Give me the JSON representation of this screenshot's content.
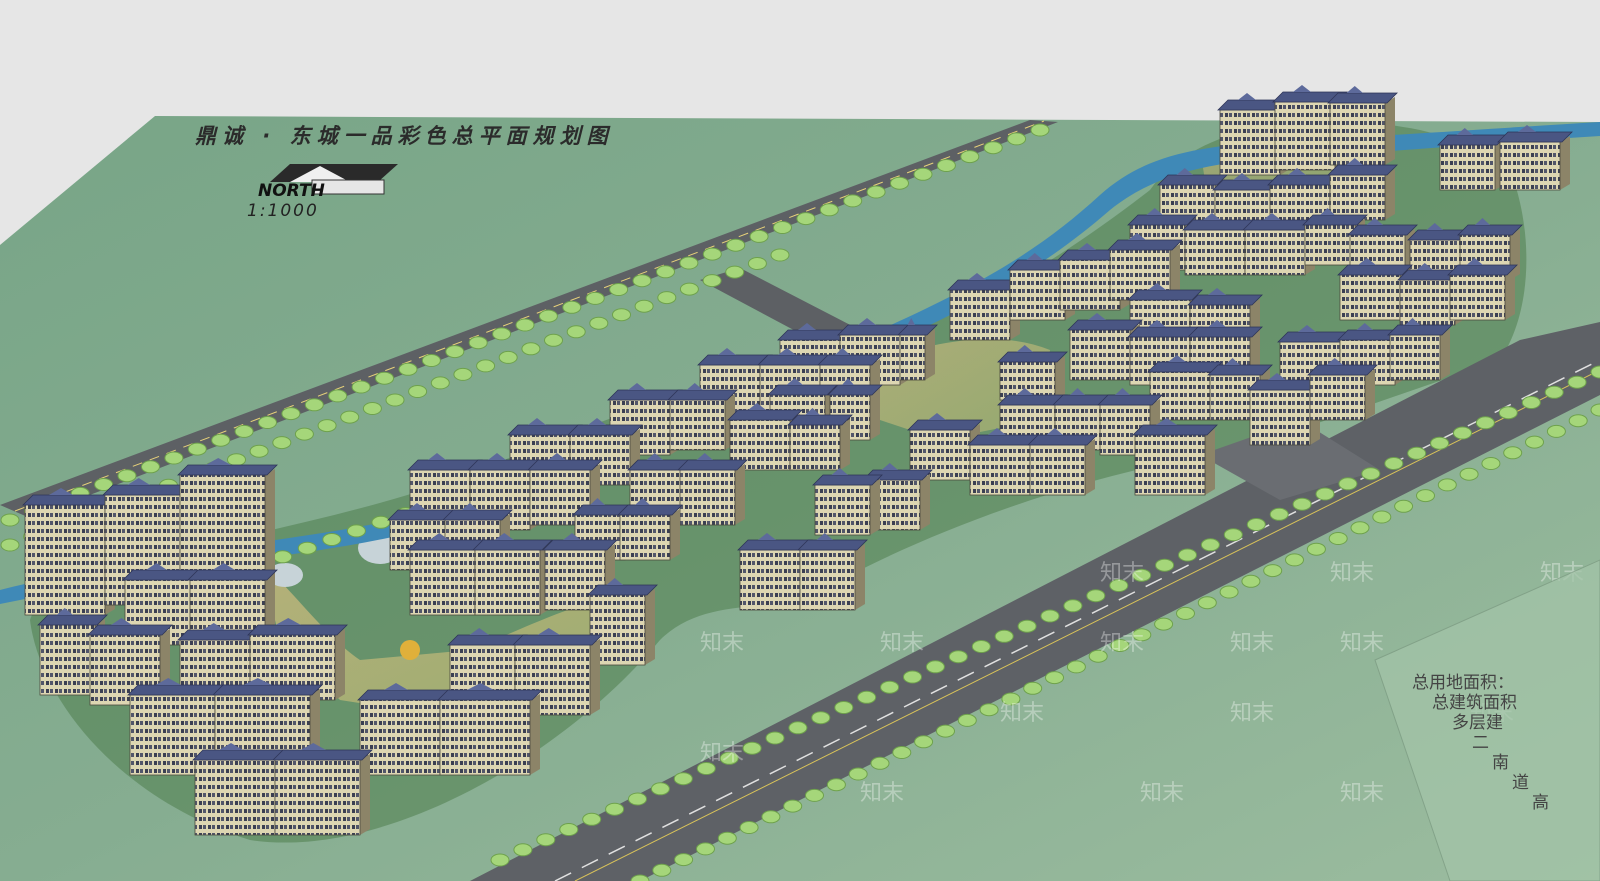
{
  "plan": {
    "title": "鼎诚 · 东城一品彩色总平面规划图",
    "scale": "1:1000",
    "north_label": "NORTH"
  },
  "watermark": {
    "text": "知末"
  },
  "legend_fragments": [
    "总用地面积：",
    "总建筑面积",
    "多层建",
    "二",
    "南",
    "道",
    "高"
  ],
  "colors": {
    "sky": "#e6e6e6",
    "ground": "#86ab8f",
    "road": "#5d6064",
    "river": "#3f89b7",
    "tree": "#a8d57a",
    "facade": "#d8d1ad",
    "roof": "#4a5683"
  }
}
